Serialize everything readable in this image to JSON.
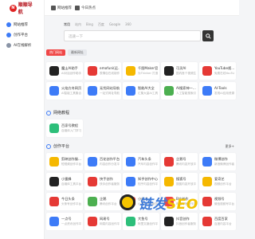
{
  "brand": {
    "mark": "N",
    "name": "顺顺导航"
  },
  "sidebar": {
    "items": [
      {
        "label": "网站推荐"
      },
      {
        "label": "创作平台"
      },
      {
        "label": "AI在线解析"
      }
    ]
  },
  "topbar": {
    "links": [
      {
        "label": "网站推荐"
      },
      {
        "label": "今日热点"
      }
    ]
  },
  "search": {
    "tabs": [
      "常用",
      "站内",
      "Bing",
      "百度",
      "Google",
      "360"
    ],
    "placeholder": "迅速一下",
    "button_icon": "search-icon"
  },
  "tabs": [
    {
      "label": "热门网站",
      "active": true
    },
    {
      "label": "最新网址",
      "active": false
    }
  ],
  "featured": [
    {
      "title": "魔土AI助手",
      "desc": "AI对话创作助手",
      "color": "#222222"
    },
    {
      "title": "emofuni(运...",
      "desc": "表情包在线制作",
      "color": "#e53935"
    },
    {
      "title": "千图Maker官...",
      "desc": "为Thinker 打造...",
      "color": "#f5b800"
    },
    {
      "title": "可灵AI",
      "desc": "国内首个视频生...",
      "color": "#222222"
    },
    {
      "title": "YouTube视...",
      "desc": "免费在线YouTube...",
      "color": "#e53935"
    },
    {
      "title": "火焰方舟网页",
      "desc": "AI智能工具集合",
      "color": "#3d7bf7"
    },
    {
      "title": "无忧网站导航",
      "desc": "一站式网址导航",
      "color": "#3d7bf7"
    },
    {
      "title": "智能AI大全",
      "desc": "汇集大量AI工具...",
      "color": "#3d7bf7"
    },
    {
      "title": "AI搜索神一...",
      "desc": "人工智能搜索引擎",
      "color": "#4caf50"
    },
    {
      "title": "AI-Tools",
      "desc": "发现AI应用资源...",
      "color": "#3d7bf7"
    }
  ],
  "sections": [
    {
      "title": "网络教程",
      "more": "",
      "cards": [
        {
          "title": "百家号教程",
          "desc": "自媒体入门学习",
          "color": "#2dbf7a"
        }
      ]
    },
    {
      "title": "创作平台",
      "more": "更多+",
      "cards": [
        {
          "title": "剪映创作服...",
          "desc": "短视频创作平台",
          "color": "#f5b800"
        },
        {
          "title": "百花创作平台",
          "desc": "内容创作分发平台",
          "color": "#3d7bf7"
        },
        {
          "title": "汽车头条",
          "desc": "汽车内容创作平台",
          "color": "#3d7bf7"
        },
        {
          "title": "企鹅号",
          "desc": "腾讯内容开放平台",
          "color": "#e53935"
        },
        {
          "title": "微博创作",
          "desc": "新浪微博创作者...",
          "color": "#3d7bf7"
        },
        {
          "title": "小蜜蜂",
          "desc": "自媒体工具平台",
          "color": "#222222"
        },
        {
          "title": "快手创作",
          "desc": "快手创作者服务...",
          "color": "#e53935"
        },
        {
          "title": "知乎创作中心",
          "desc": "知乎内容创作平台",
          "color": "#3d7bf7"
        },
        {
          "title": "搜狐号",
          "desc": "搜狐内容开放平台",
          "color": "#f5b800"
        },
        {
          "title": "爱奇艺",
          "desc": "视频创作平台",
          "color": "#f5b800"
        },
        {
          "title": "今日头条",
          "desc": "头条号创作平台",
          "color": "#e53935"
        },
        {
          "title": "企鹅",
          "desc": "腾讯创作平台",
          "color": "#4caf50"
        },
        {
          "title": "小红书",
          "desc": "小红书创作服务...",
          "color": "#e53935"
        },
        {
          "title": "B站创作",
          "desc": "哔哩哔哩创作中心",
          "color": "#f04747"
        },
        {
          "title": "视频号",
          "desc": "微信视频号平台",
          "color": "#e53935"
        },
        {
          "title": "一点号",
          "desc": "一点资讯创作平台",
          "color": "#3d7bf7"
        },
        {
          "title": "网易号",
          "desc": "网易内容创作平台",
          "color": "#e53935"
        },
        {
          "title": "大鱼号",
          "desc": "阿里文娱创作平台",
          "color": "#2dbf7a"
        },
        {
          "title": "抖音创作",
          "desc": "抖音创作者服务...",
          "color": "#222222"
        },
        {
          "title": "百度百家",
          "desc": "百度内容平台",
          "color": "#e53935"
        }
      ]
    }
  ],
  "watermark": {
    "text_a": "链发",
    "text_b": "SEO"
  }
}
